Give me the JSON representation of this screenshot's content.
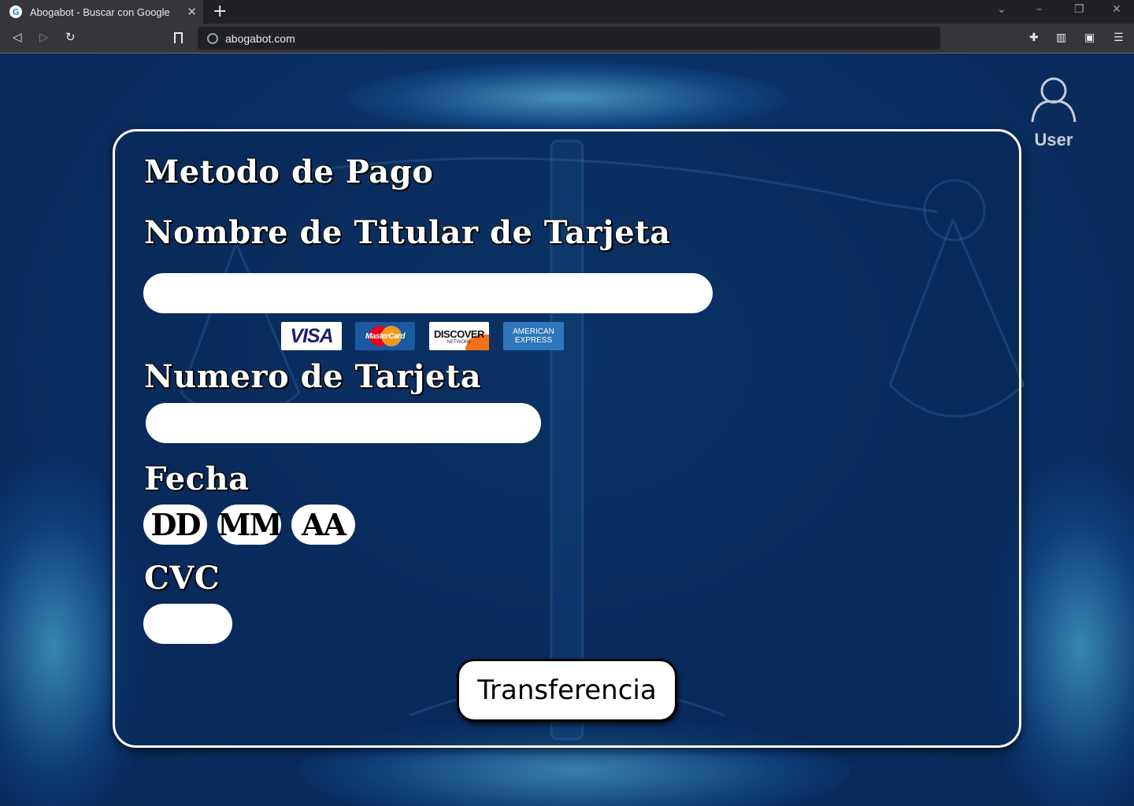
{
  "browser": {
    "tab_title": "Abogabot - Buscar con Google",
    "url": "abogabot.com",
    "favicon_letter": "G"
  },
  "user": {
    "label": "User"
  },
  "form": {
    "title": "Metodo de Pago",
    "holder_label": "Nombre de Titular de Tarjeta",
    "holder_value": "",
    "card_logos": {
      "visa": "VISA",
      "mastercard": "MasterCard",
      "discover": "DISCOVER",
      "discover_sub": "NETWORK",
      "amex_line1": "AMERICAN",
      "amex_line2": "EXPRESS"
    },
    "number_label": "Numero de Tarjeta",
    "number_value": "",
    "date_label": "Fecha",
    "date_day": "DD",
    "date_month": "MM",
    "date_year": "AA",
    "cvc_label": "CVC",
    "cvc_value": "",
    "submit_label": "Transferencia"
  },
  "icons": [
    "back-icon",
    "forward-icon",
    "reload-icon",
    "bookmark-icon",
    "globe-icon",
    "extensions-icon",
    "side-panel-icon",
    "wallet-icon",
    "menu-icon",
    "user-icon"
  ]
}
